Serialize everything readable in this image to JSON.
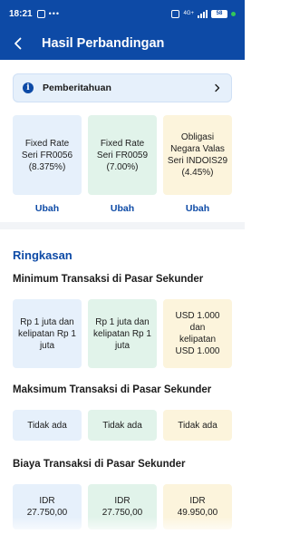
{
  "status_bar": {
    "time": "18:21",
    "dots": "•••",
    "network": "4G+",
    "battery": "58"
  },
  "header": {
    "title": "Hasil Perbandingan",
    "back_icon": "arrow-left-icon"
  },
  "notice": {
    "label": "Pemberitahuan",
    "icon": "info-icon"
  },
  "products": [
    {
      "name": "Fixed Rate Seri FR0056 (8.375%)",
      "color": "#e6f0fb",
      "action": "Ubah"
    },
    {
      "name": "Fixed Rate Seri FR0059 (7.00%)",
      "color": "#e1f3ea",
      "action": "Ubah"
    },
    {
      "name": "Obligasi Negara Valas Seri INDOIS29 (4.45%)",
      "color": "#fcf4dc",
      "action": "Ubah"
    }
  ],
  "summary": {
    "title": "Ringkasan",
    "min_transaction": {
      "label": "Minimum Transaksi di Pasar Sekunder",
      "values": [
        "Rp 1 juta dan kelipatan Rp 1 juta",
        "Rp 1 juta dan kelipatan Rp 1 juta",
        "USD 1.000 dan kelipatan USD 1.000"
      ]
    },
    "max_transaction": {
      "label": "Maksimum Transaksi di Pasar Sekunder",
      "values": [
        "Tidak ada",
        "Tidak ada",
        "Tidak ada"
      ]
    },
    "fee": {
      "label": "Biaya Transaksi di Pasar Sekunder",
      "values": [
        "IDR 27.750,00",
        "IDR 27.750,00",
        "IDR 49.950,00"
      ]
    }
  },
  "colors": {
    "primary": "#0d4aa6",
    "card_blue": "#e6f0fb",
    "card_green": "#e1f3ea",
    "card_yellow": "#fcf4dc"
  }
}
